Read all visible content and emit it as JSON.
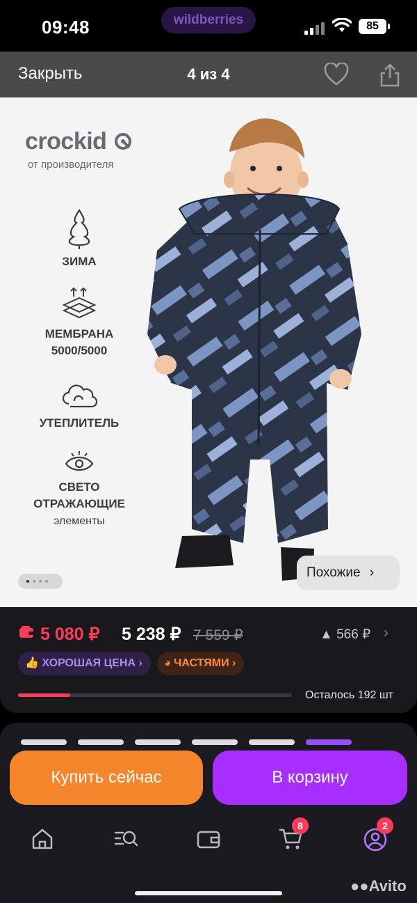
{
  "status_bar": {
    "time": "09:48",
    "app_label": "wildberries",
    "battery": "85"
  },
  "viewer": {
    "close_label": "Закрыть",
    "counter": "4 из 4",
    "icons": [
      "heart-icon",
      "share-icon"
    ]
  },
  "product_image": {
    "brand": "crockid",
    "brand_sub": "от производителя",
    "features": [
      {
        "icon": "tree-icon",
        "lines": [
          "ЗИМА"
        ]
      },
      {
        "icon": "membrane-icon",
        "lines": [
          "МЕМБРАНА",
          "5000/5000"
        ]
      },
      {
        "icon": "cloud-icon",
        "lines": [
          "УТЕПЛИТЕЛЬ"
        ]
      },
      {
        "icon": "eye-icon",
        "lines": [
          "СВЕТО",
          "ОТРАЖАЮЩИЕ"
        ],
        "small": "элементы"
      }
    ],
    "similar_label": "Похожие",
    "image_count": 4,
    "active_image": 1
  },
  "price": {
    "wallet_price": "5 080 ₽",
    "price": "5 238 ₽",
    "old_price": "7 559 ₽",
    "delta": "566 ₽",
    "good_price_label": "ХОРОШАЯ ЦЕНА",
    "installments_label": "ЧАСТЯМИ",
    "stock_text": "Осталось 192 шт",
    "stock_fraction": 0.19
  },
  "actions": {
    "buy_now": "Купить сейчас",
    "add_to_cart": "В корзину"
  },
  "bottom_nav": {
    "items": [
      "home-icon",
      "catalog-search-icon",
      "wallet-icon",
      "cart-icon",
      "profile-icon"
    ],
    "cart_badge": "8",
    "profile_badge": "2"
  },
  "watermark": "Avito",
  "colors": {
    "wallet_red": "#ff3b5c",
    "buy_orange": "#f5852a",
    "cart_purple": "#a82dff",
    "panel": "#19181d"
  }
}
